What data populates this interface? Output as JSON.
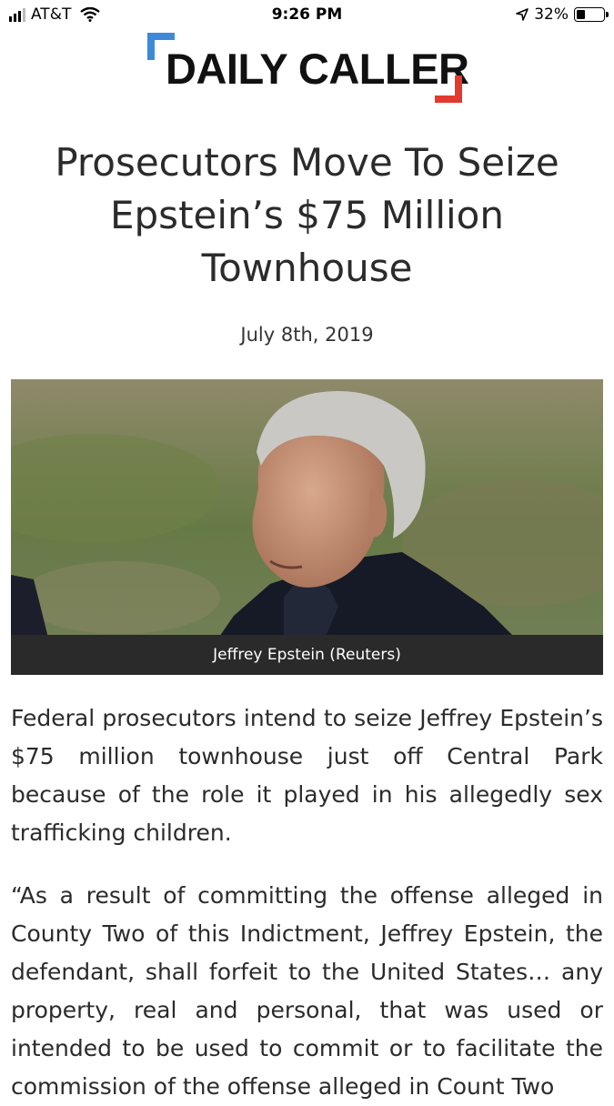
{
  "status_bar": {
    "carrier": "AT&T",
    "time": "9:26 PM",
    "battery_percent": "32%",
    "battery_level": 0.32,
    "icons": [
      "signal-icon",
      "wifi-icon",
      "location-arrow-icon",
      "battery-icon"
    ]
  },
  "header": {
    "logo_text": "DAILY CALLER",
    "colors": {
      "bracket_left": "#3f8ad8",
      "bracket_right": "#e23a2e"
    }
  },
  "article": {
    "headline": "Prosecutors Move To Seize Epstein’s $75 Million Townhouse",
    "date": "July 8th, 2019",
    "image_caption": "Jeffrey Epstein (Reuters)",
    "paragraphs": [
      "Federal prosecutors intend to seize Jeffrey Epstein’s $75 million townhouse just off Central Park because of the role it played in his allegedly sex trafficking children.",
      "“As a result of committing the offense alleged in County Two of this Indictment, Jeffrey Epstein, the defendant, shall forfeit to the United States… any property, real and personal, that was used or intended to be used to commit or to facilitate the commission of the offense alleged in Count Two"
    ]
  }
}
